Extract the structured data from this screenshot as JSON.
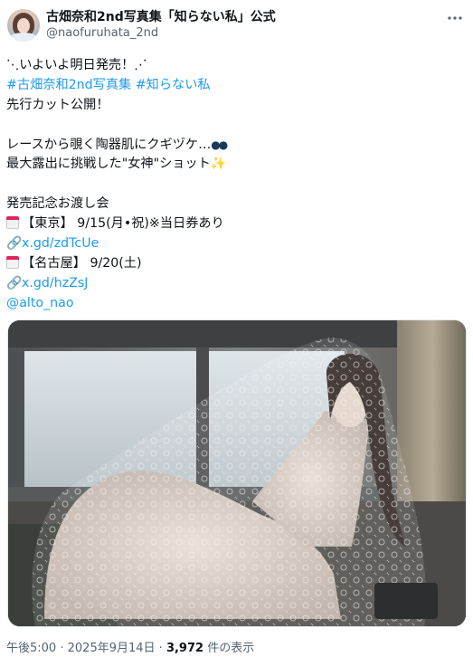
{
  "header": {
    "display_name": "古畑奈和2nd写真集「知らない私」公式",
    "handle": "@naofuruhata_2nd",
    "more_icon": "more-horizontal-icon"
  },
  "tweet": {
    "line1": "⋱いよいよ明日発売！⋰",
    "hashtag1": "#古畑奈和2nd写真集",
    "hashtag2": "#知らない私",
    "line3": "先行カット公開！",
    "line4": "レースから覗く陶器肌にクギヅケ…",
    "line5": "最大露出に挑戦した\"女神\"ショット",
    "line6": "発売記念お渡し会",
    "event1": "【東京】 9/15(月•祝)※当日券あり",
    "link1": "x.gd/zdTcUe",
    "event2": "【名古屋】 9/20(土)",
    "link2": "x.gd/hzZsJ",
    "mention": "@alto_nao",
    "icons": {
      "calendar": "calendar-icon",
      "link": "link-icon",
      "eyes": "eyes-emoji-icon",
      "sparkles": "sparkles-emoji-icon"
    }
  },
  "media": {
    "type": "photo"
  },
  "meta": {
    "time": "午後5:00",
    "separator": "·",
    "date": "2025年9月14日",
    "views": "3,972",
    "views_label": "件の表示"
  },
  "colors": {
    "link": "#1d9bf0",
    "text": "#0f1419",
    "secondary": "#536471"
  }
}
